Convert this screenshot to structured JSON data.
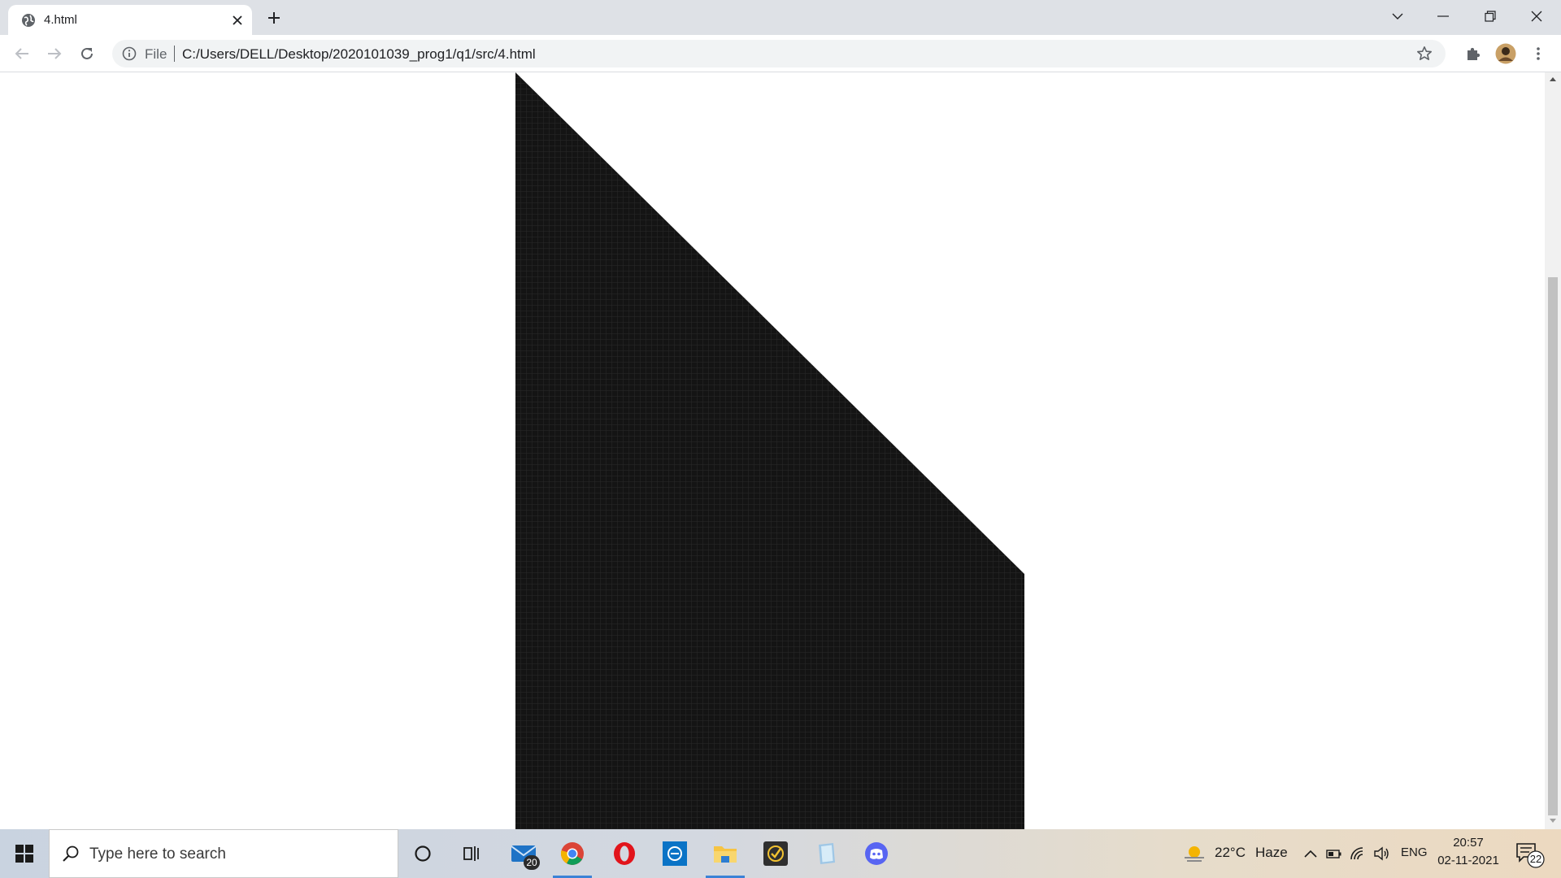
{
  "browser": {
    "tab_title": "4.html",
    "omnibox_label": "File",
    "url": "C:/Users/DELL/Desktop/2020101039_prog1/q1/src/4.html"
  },
  "page": {
    "shape_color": "#141414",
    "grid_color": "#2a2a2a"
  },
  "taskbar": {
    "search_placeholder": "Type here to search",
    "mail_badge": "20",
    "weather_temp": "22°C",
    "weather_desc": "Haze",
    "language": "ENG",
    "time": "20:57",
    "date": "02-11-2021",
    "notification_count": "22",
    "apps": [
      "cortana",
      "task-view",
      "mail",
      "chrome",
      "opera",
      "dell-app",
      "file-explorer",
      "todo-app",
      "notepad-app",
      "discord"
    ]
  }
}
